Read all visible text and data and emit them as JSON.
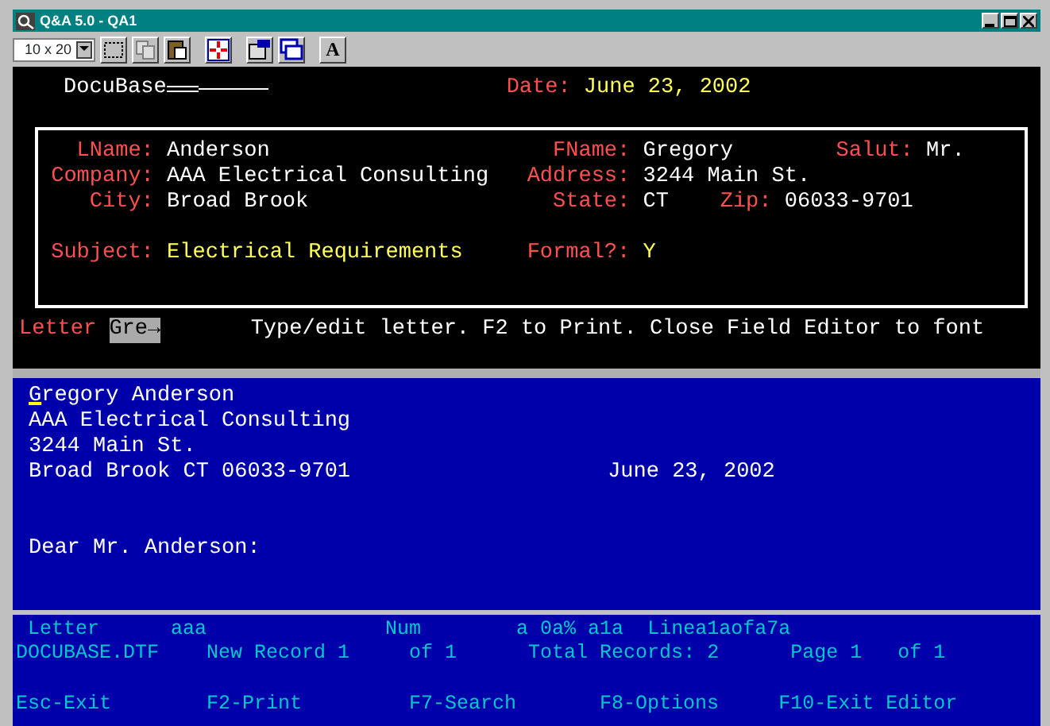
{
  "window": {
    "title": "Q&A 5.0 - QA1"
  },
  "toolbar": {
    "font_size": "10 x 20",
    "font_button": "A"
  },
  "header": {
    "title": "DocuBase",
    "date_label": "Date:",
    "date": "June 23, 2002"
  },
  "form": {
    "rows": [
      [
        {
          "label": "LName:",
          "value": "Anderson",
          "kind": "plain"
        },
        {
          "label": "FName:",
          "value": "Gregory",
          "kind": "plain"
        },
        {
          "label": "Salut:",
          "value": "Mr.",
          "kind": "plain"
        }
      ],
      [
        {
          "label": "Company:",
          "value": "AAA Electrical Consulting",
          "kind": "plain"
        },
        {
          "label": "Address:",
          "value": "3244 Main St.",
          "kind": "plain"
        }
      ],
      [
        {
          "label": "City:",
          "value": "Broad Brook",
          "kind": "plain"
        },
        {
          "label": "State:",
          "value": "CT",
          "kind": "plain"
        },
        {
          "label": "Zip:",
          "value": "06033-9701",
          "kind": "plain"
        }
      ],
      [
        {
          "label": "Subject:",
          "value": "Electrical Requirements",
          "kind": "highlight"
        },
        {
          "label": "Formal?:",
          "value": "Y",
          "kind": "highlight"
        }
      ]
    ]
  },
  "prompt": {
    "field": "Letter",
    "tab": "Gre→",
    "message": "Type/edit letter. F2 to Print. Close Field Editor to font"
  },
  "letter": {
    "lines": [
      {
        "text": "Gregory Anderson",
        "kind": "cursor"
      },
      {
        "text": "AAA Electrical Consulting",
        "kind": "plain"
      },
      {
        "text": "3244 Main St.",
        "kind": "plain"
      },
      {
        "text": "Broad Brook CT 06033-9701",
        "right_text": "June 23, 2002",
        "kind": "plain"
      },
      {
        "text": "Dear Mr. Anderson:",
        "kind": "salutation"
      }
    ]
  },
  "status_lines": [
    [
      "Letter",
      "aaa",
      "Num",
      "a 0a% a1a",
      "Linea1aofa7a"
    ],
    [
      "DOCUBASE.DTF",
      "New Record 1",
      "of 1",
      "Total Records: 2",
      "Page 1",
      "of 1"
    ]
  ],
  "function_keys": [
    "Esc-Exit",
    "F2-Print",
    "F7-Search",
    "F8-Options",
    "F10-Exit Editor"
  ]
}
